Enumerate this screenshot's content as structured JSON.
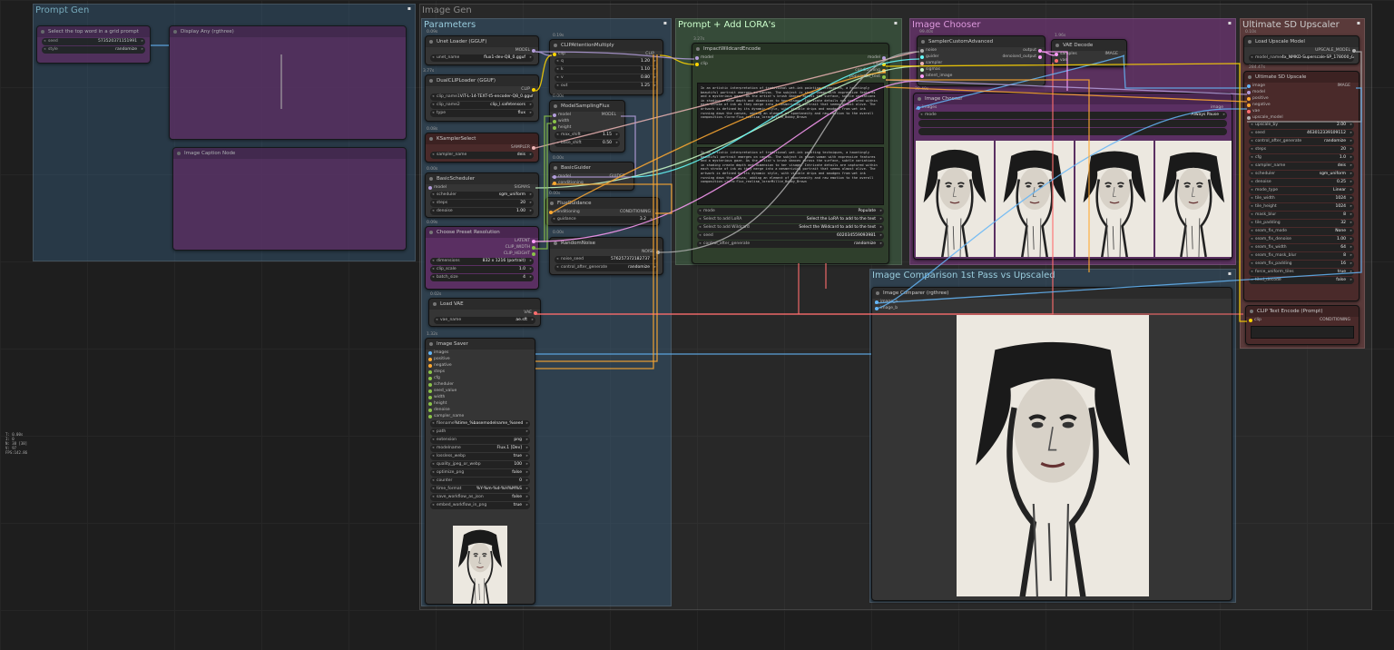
{
  "groups": {
    "prompt_gen": "Prompt Gen",
    "image_gen": "Image Gen",
    "parameters": "Parameters",
    "prompt_lora": "Prompt + Add LORA's",
    "image_chooser": "Image Chooser",
    "upscaler": "Ultimate SD Upscaler",
    "comparison": "Image Comparison 1st Pass vs Upscaled"
  },
  "nodes": {
    "unet": {
      "time": "0.09s",
      "title": "Unet Loader (GGUF)",
      "out": "MODEL",
      "unet_name_label": "unet_name",
      "unet_name": "flux1-dev-Q8_0.gguf"
    },
    "dualclip": {
      "time": "3.77s",
      "title": "DualCLIPLoader (GGUF)",
      "out": "CLIP",
      "clip1_label": "clip_name1",
      "clip1": "ViT-L-14-TEXT-t5-encoder-Q8_0.gguf",
      "clip2_label": "clip_name2",
      "clip2": "clip_l.safetensors",
      "type_label": "type",
      "type": "flux"
    },
    "clipattn": {
      "time": "0.19s",
      "title": "CLIPAttentionMultiply",
      "in": "clip",
      "out": "CLIP",
      "q_label": "q",
      "q": "1.20",
      "k_label": "k",
      "k": "1.10",
      "v_label": "v",
      "v": "0.80",
      "o_label": "out",
      "o": "1.25"
    },
    "modelsampling": {
      "time": "0.00s",
      "title": "ModelSamplingFlux",
      "in_model": "model",
      "in_width": "width",
      "in_height": "height",
      "out": "MODEL",
      "max_label": "max_shift",
      "max": "1.15",
      "base_label": "base_shift",
      "base": "0.50"
    },
    "ksampler": {
      "time": "0.08s",
      "title": "KSamplerSelect",
      "out": "SAMPLER",
      "sampler_label": "sampler_name",
      "sampler": "deis"
    },
    "scheduler": {
      "time": "0.00s",
      "title": "BasicScheduler",
      "in": "model",
      "out": "SIGMAS",
      "sched_label": "scheduler",
      "sched": "sgm_uniform",
      "steps_label": "steps",
      "steps": "20",
      "denoise_label": "denoise",
      "denoise": "1.00"
    },
    "guider": {
      "time": "0.00s",
      "title": "BasicGuider",
      "in_model": "model",
      "in_cond": "conditioning",
      "out": "GUIDER"
    },
    "fluxguid": {
      "time": "0.00s",
      "title": "FluxGuidance",
      "in": "conditioning",
      "out": "CONDITIONING",
      "g_label": "guidance",
      "g": "3.2"
    },
    "preset": {
      "time": "0.09s",
      "title": "Choose Preset Resolution",
      "out1": "LATENT",
      "out2": "CLIP_WIDTH",
      "out3": "CLIP_HEIGHT",
      "dim_label": "dimensions",
      "dim": "832 x 1216 (portrait)",
      "cs_label": "clip_scale",
      "cs": "1.0",
      "bs_label": "batch_size",
      "bs": "4"
    },
    "noise": {
      "time": "0.00s",
      "title": "RandomNoise",
      "out": "NOISE",
      "seed_label": "noise_seed",
      "seed": "576257372182737",
      "ctrl_label": "control_after_generate",
      "ctrl": "randomize"
    },
    "vae": {
      "time": "0.02s",
      "title": "Load VAE",
      "out": "VAE",
      "vae_label": "vae_name",
      "vae": "ae.sft"
    },
    "saver": {
      "time": "1.32s",
      "title": "Image Saver",
      "inputs": [
        "images",
        "positive",
        "negative",
        "steps",
        "cfg",
        "scheduler",
        "seed_value",
        "width",
        "height",
        "denoise",
        "sampler_name"
      ],
      "widgets": [
        {
          "k": "filename",
          "v": "%time_%basemodelname_%seed"
        },
        {
          "k": "path",
          "v": ""
        },
        {
          "k": "extension",
          "v": "png"
        },
        {
          "k": "modelname",
          "v": "Flux.1 [Dev]"
        },
        {
          "k": "lossless_webp",
          "v": "true"
        },
        {
          "k": "quality_jpeg_or_webp",
          "v": "100"
        },
        {
          "k": "optimize_png",
          "v": "false"
        },
        {
          "k": "counter",
          "v": "0"
        },
        {
          "k": "time_format",
          "v": "%Y-%m-%d-%H%M%S"
        },
        {
          "k": "save_workflow_as_json",
          "v": "false"
        },
        {
          "k": "embed_workflow_in_png",
          "v": "true"
        }
      ]
    },
    "wildcard": {
      "time": "3.27s",
      "title": "ImpactWildcardEncode",
      "in1": "model",
      "in2": "clip",
      "outs": [
        "model",
        "clip",
        "conditioning",
        "populated_text"
      ],
      "text1": "In an artistic interpretation of traditional wet-ink painting techniques, a hauntingly beautiful portrait emerges on canvas. The subject is shown woman with expressive features and a mysterious gaze. As the artist's brush dances across the surface, subtle variations in shading create depth and dimension to her visage. Intricate details are captured within each stroke of ink as they merge into a mesmerizing portrait that seems almost alive. The artwork is defined by its dynamic style, with visible drips and smudges from wet ink running down the canvas, adding an element of spontaneity and raw emotion to the overall composition.<lora:flux_realism_lora>Millie_Bobby_Brown",
      "text2": "In an artistic interpretation of traditional wet-ink painting techniques, a hauntingly beautiful portrait emerges on canvas. The subject is shown woman with expressive features and a mysterious gaze. As the artist's brush dances across the surface, subtle variations in shading create depth and dimension to her visage. Intricate details are captured within each stroke of ink as they merge into a mesmerizing portrait that seems almost alive. The artwork is defined by its dynamic style, with visible drips and smudges from wet ink running down the canvas, adding an element of spontaneity and raw emotion to the overall composition.<lora:flux_realism_lora>Millie_Bobby_Brown",
      "w": [
        {
          "k": "mode",
          "v": "Populate"
        },
        {
          "k": "Select to add LoRA",
          "v": "Select the LoRA to add to the text"
        },
        {
          "k": "Select to add Wildcard",
          "v": "Select the Wildcard to add to the text"
        },
        {
          "k": "seed",
          "v": "602034559093981"
        },
        {
          "k": "control_after_generate",
          "v": "randomize"
        }
      ]
    },
    "sampleradv": {
      "time": "99.40s",
      "title": "SamplerCustomAdvanced",
      "ins": [
        "noise",
        "guider",
        "sampler",
        "sigmas",
        "latent_image"
      ],
      "outs": [
        "output",
        "denoised_output"
      ]
    },
    "vaedecode": {
      "time": "1.96s",
      "title": "VAE Decode",
      "ins": [
        "samples",
        "vae"
      ],
      "out": "IMAGE"
    },
    "chooser": {
      "time": "30.40s",
      "title": "Image Chooser",
      "in": "images",
      "out": "image",
      "mode_label": "mode",
      "mode": "Always Pause"
    },
    "upmodel": {
      "time": "0.10s",
      "title": "Load Upscale Model",
      "out": "UPSCALE_MODEL",
      "model_label": "model_name",
      "model": "4x_NMKD-Superscale-SP_178000_G.pth"
    },
    "ultimate": {
      "time": "284.47s",
      "title": "Ultimate SD Upscale",
      "ins": [
        "image",
        "model",
        "positive",
        "negative",
        "vae",
        "upscale_model"
      ],
      "out": "IMAGE",
      "w": [
        {
          "k": "upscale_by",
          "v": "2.00"
        },
        {
          "k": "seed",
          "v": "463012339109112"
        },
        {
          "k": "control_after_generate",
          "v": "randomize"
        },
        {
          "k": "steps",
          "v": "20"
        },
        {
          "k": "cfg",
          "v": "1.0"
        },
        {
          "k": "sampler_name",
          "v": "deis"
        },
        {
          "k": "scheduler",
          "v": "sgm_uniform"
        },
        {
          "k": "denoise",
          "v": "0.25"
        },
        {
          "k": "mode_type",
          "v": "Linear"
        },
        {
          "k": "tile_width",
          "v": "1024"
        },
        {
          "k": "tile_height",
          "v": "1024"
        },
        {
          "k": "mask_blur",
          "v": "8"
        },
        {
          "k": "tile_padding",
          "v": "32"
        },
        {
          "k": "seam_fix_mode",
          "v": "None"
        },
        {
          "k": "seam_fix_denoise",
          "v": "1.00"
        },
        {
          "k": "seam_fix_width",
          "v": "64"
        },
        {
          "k": "seam_fix_mask_blur",
          "v": "8"
        },
        {
          "k": "seam_fix_padding",
          "v": "16"
        },
        {
          "k": "force_uniform_tiles",
          "v": "true"
        },
        {
          "k": "tiled_decode",
          "v": "false"
        }
      ]
    },
    "cliptext": {
      "time": "",
      "title": "CLIP Text Encode (Prompt)",
      "in": "clip",
      "out": "CONDITIONING"
    },
    "comparer": {
      "title": "Image Comparer (rgthree)",
      "in1": "image_a",
      "in2": "image_b"
    },
    "pg1": {
      "title": "Select the top word in a grid prompt",
      "w1": "seed",
      "v1": "573520371151991",
      "w2": "style",
      "v2": "randomize"
    },
    "pg2": {
      "title": "Display Any (rgthree)"
    },
    "pg3": {
      "title": "Image Caption Node"
    }
  },
  "stats": [
    "T: 0.00s",
    "I: 0",
    "N: 38 [38]",
    "V: 97",
    "FPS:142.86"
  ]
}
